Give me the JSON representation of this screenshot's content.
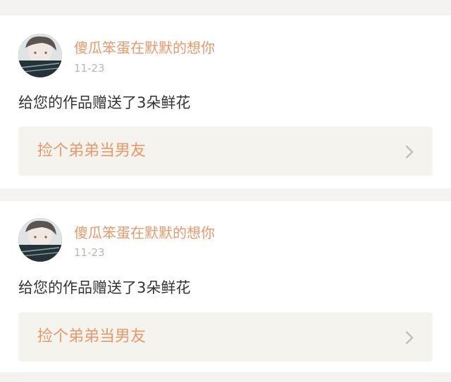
{
  "notifications": [
    {
      "username": "傻瓜笨蛋在默默的想你",
      "date": "11-23",
      "message": "给您的作品赠送了3朵鲜花",
      "work_title": "捡个弟弟当男友",
      "icon": "chevron-right-icon"
    },
    {
      "username": "傻瓜笨蛋在默默的想你",
      "date": "11-23",
      "message": "给您的作品赠送了3朵鲜花",
      "work_title": "捡个弟弟当男友",
      "icon": "chevron-right-icon"
    }
  ],
  "colors": {
    "accent": "#e7996a",
    "background": "#f5f3f2",
    "card": "#ffffff",
    "link_box": "#f4f3ee",
    "date": "#b7b7b7",
    "text": "#333333"
  }
}
